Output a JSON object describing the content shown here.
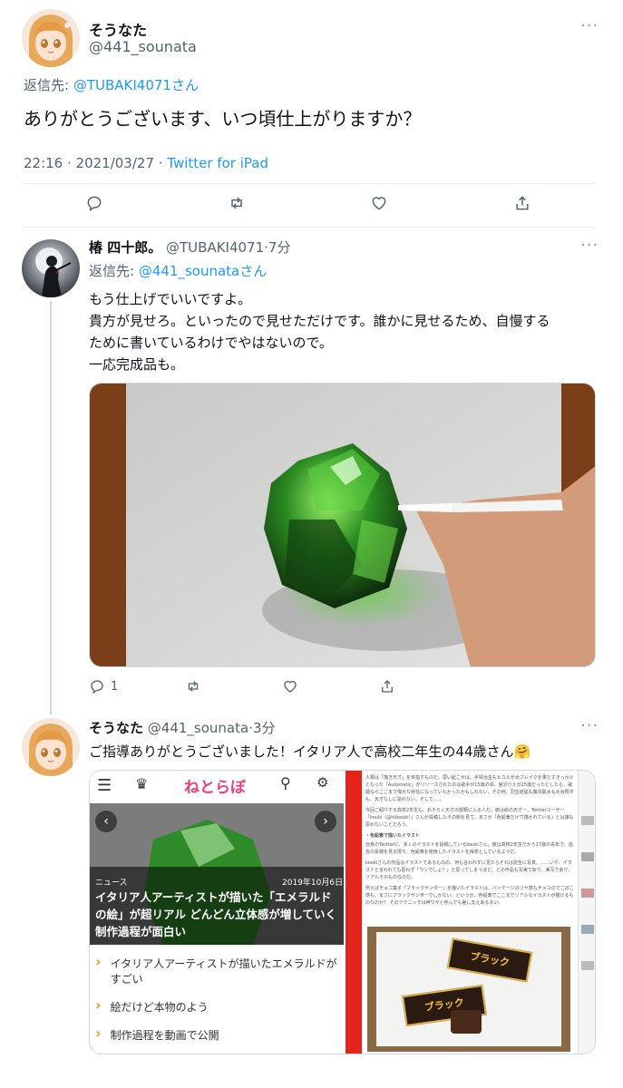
{
  "tweet1": {
    "display_name": "そうなた",
    "handle": "@441_sounata",
    "reply_prefix": "返信先: ",
    "reply_to": "@TUBAKI4071さん",
    "text": "ありがとうございます、いつ頃仕上がりますか？",
    "meta_time": "22:16 · 2021/03/27 · ",
    "meta_source": "Twitter for iPad",
    "more": "···"
  },
  "tweet2": {
    "display_name": "椿 四十郎。",
    "handle": "@TUBAKI4071",
    "time": "·7分",
    "reply_prefix": "返信先: ",
    "reply_to": "@441_sounataさん",
    "line1": "もう仕上げでいいですよ。",
    "line2": "貴方が見せろ。といったので見せただけです。誰かに見せるため、自慢する",
    "line3": "ために書いているわけでやはないので。",
    "line4": "一応完成品も。",
    "reply_count": "1",
    "more": "···"
  },
  "tweet3": {
    "display_name": "そうなた",
    "handle": "@441_sounata",
    "time": "·3分",
    "text": "ご指導ありがとうございました！イタリア人で高校二年生の44歳さん🤗",
    "more": "···",
    "article": {
      "logo": "ねとらぼ",
      "category": "ニュース",
      "date": "2019年10月6日",
      "headline": "イタリア人アーティストが描いた「エメラルドの絵」が超リアル どんどん立体感が増していく制作過程が面白い",
      "bullets": [
        "イタリア人アーティストが描いたエメラルドがすごい",
        "絵だけど本物のよう",
        "制作過程を動画で公開"
      ],
      "body1": "人類は「描き天才」を目指すものだ。思い起こせば、手塚治虫もヒカルが大ブレイクを果たすきっかけとなった「Automatic」がリリースされたのは歌手が15歳の頃。宮沢りえが25歳だったとしたら、歌姫ならここまで偉大な存在になっていなかったかもしれない。その他、羽生結弦も藤井聡太も大谷翔平も、天才なしに語れない。そして……",
      "body2": "今回ご紹介する高校2年生も、おそらく天才の部類に入る人だ。彼は絵の天才ー。Twitterユーザー「kouki（@hkkouki）」さんが投稿したその絵を見て、まさか「色鉛筆だけで描かれている」とは誰も思わないことだろう。",
      "subhead": "・色鉛筆で描いたイラスト",
      "body3": "自身のTwitterに、多くのイラストを投稿しているkoukiさん。彼は高校2年生だから17歳の青年で、過去の投稿を見る限り、色鉛筆を使用したイラストを得意としているようだ。",
      "body4": "koukiさんの作品はイラストであるものの、何も言われずに見たらそれは完全に写真。……いや、イラストと言われても思わず「ウソでしょ？」と思ってしまうほど、どの作品も写実であり、美写であり、リアルそのものなのだ。",
      "body5": "例えばチョコ菓子「ブラックサンダー」を描いたイラストは、パッケージのツヤ感もチョコのでこぼこ感も、まさにブラックサンダーでしかない。というか、色鉛筆でここまでリアルなイラストが描けるものなのか？ そのテクニックは神ワザと呼んでも差し支えあるまい。",
      "candy_label": "ブラック"
    }
  },
  "colors": {
    "accent": "#1d9bf0",
    "text": "#0f1419",
    "muted": "#536471",
    "netorabo_pink": "#e8407a",
    "red_bar": "#e3241b"
  }
}
